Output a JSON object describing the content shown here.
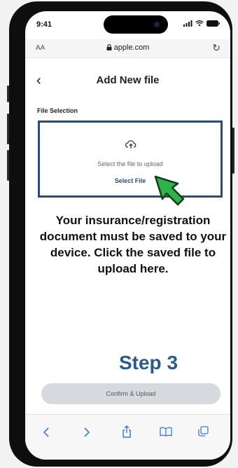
{
  "status_bar": {
    "time": "9:41"
  },
  "browser": {
    "text_size_label": "AA",
    "url": "apple.com"
  },
  "page": {
    "title": "Add New file",
    "section_label": "File Selection",
    "upload_hint": "Select the file to upload",
    "select_file_label": "Select File",
    "confirm_label": "Confirm & Upload"
  },
  "overlay": {
    "instructions": "Your insurance/registration document must be saved to your device. Click the saved file to upload here.",
    "step_label": "Step 3"
  },
  "colors": {
    "accent": "#2e4b75",
    "step_blue": "#2c5a8c",
    "arrow_green": "#2fb34a",
    "toolbar_icon": "#3a79d6"
  },
  "icons": [
    "lock-icon",
    "reload-icon",
    "back-chevron-icon",
    "cloud-upload-icon",
    "pointer-arrow-icon",
    "back-nav-icon",
    "forward-nav-icon",
    "share-icon",
    "bookmarks-icon",
    "tabs-icon"
  ]
}
